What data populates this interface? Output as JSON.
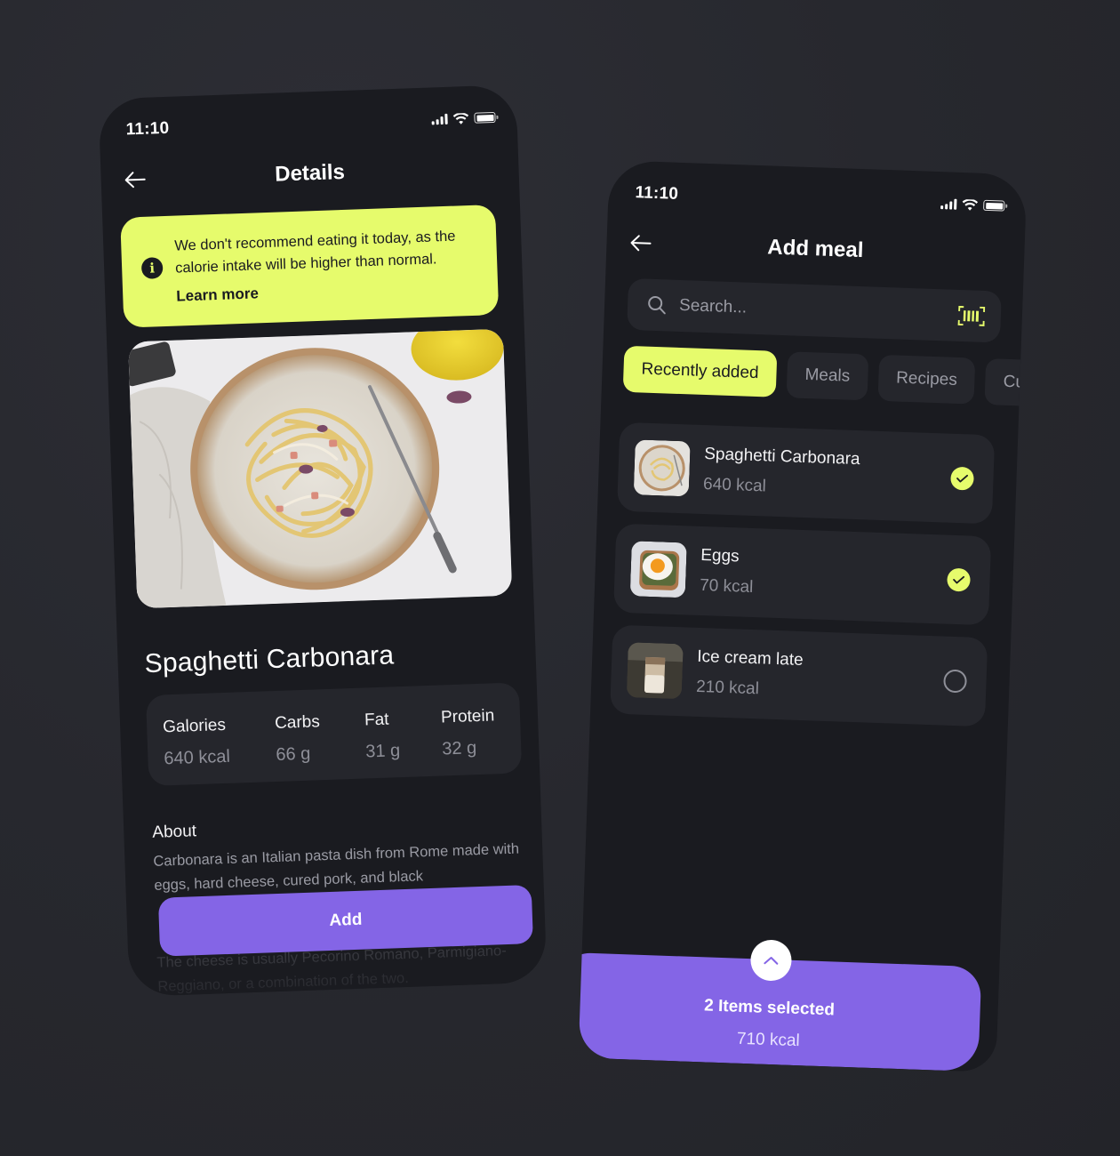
{
  "colors": {
    "background": "#27282e",
    "phone": "#1a1b20",
    "card": "#25262c",
    "accent_lime": "#e6fb6c",
    "accent_purple": "#8465e6",
    "muted_text": "#8e8f98"
  },
  "status_bar": {
    "time": "11:10",
    "icons": [
      "signal-icon",
      "wifi-icon",
      "battery-icon"
    ]
  },
  "details_screen": {
    "title": "Details",
    "back_icon": "arrow-left-icon",
    "alert": {
      "icon": "info-icon",
      "message": "We don't recommend eating it today, as the calorie intake will be higher than normal.",
      "link": "Learn more"
    },
    "dish_name": "Spaghetti Carbonara",
    "macros": [
      {
        "label": "Galories",
        "value": "640 kcal"
      },
      {
        "label": "Carbs",
        "value": "66 g"
      },
      {
        "label": "Fat",
        "value": "31 g"
      },
      {
        "label": "Protein",
        "value": "32 g"
      }
    ],
    "about": {
      "title": "About",
      "text": "Carbonara is an Italian pasta dish from Rome made with eggs, hard cheese, cured pork, and black",
      "faded_text": "The cheese is usually Pecorino Romano, Parmigiano-Reggiano, or a combination of the two."
    },
    "add_button": "Add"
  },
  "add_meal_screen": {
    "title": "Add meal",
    "back_icon": "arrow-left-icon",
    "search": {
      "placeholder": "Search...",
      "value": "",
      "scan_icon": "barcode-scan-icon"
    },
    "tabs": [
      {
        "label": "Recently added",
        "active": true
      },
      {
        "label": "Meals",
        "active": false
      },
      {
        "label": "Recipes",
        "active": false
      },
      {
        "label": "Cu",
        "active": false
      }
    ],
    "meals": [
      {
        "name": "Spaghetti Carbonara",
        "kcal": "640 kcal",
        "selected": true,
        "thumb": "pasta"
      },
      {
        "name": "Eggs",
        "kcal": "70 kcal",
        "selected": true,
        "thumb": "egg-toast"
      },
      {
        "name": "Ice cream late",
        "kcal": "210 kcal",
        "selected": false,
        "thumb": "iced-latte"
      }
    ],
    "summary": {
      "title": "2 Items selected",
      "kcal": "710 kcal",
      "expand_icon": "chevron-up-icon"
    }
  }
}
